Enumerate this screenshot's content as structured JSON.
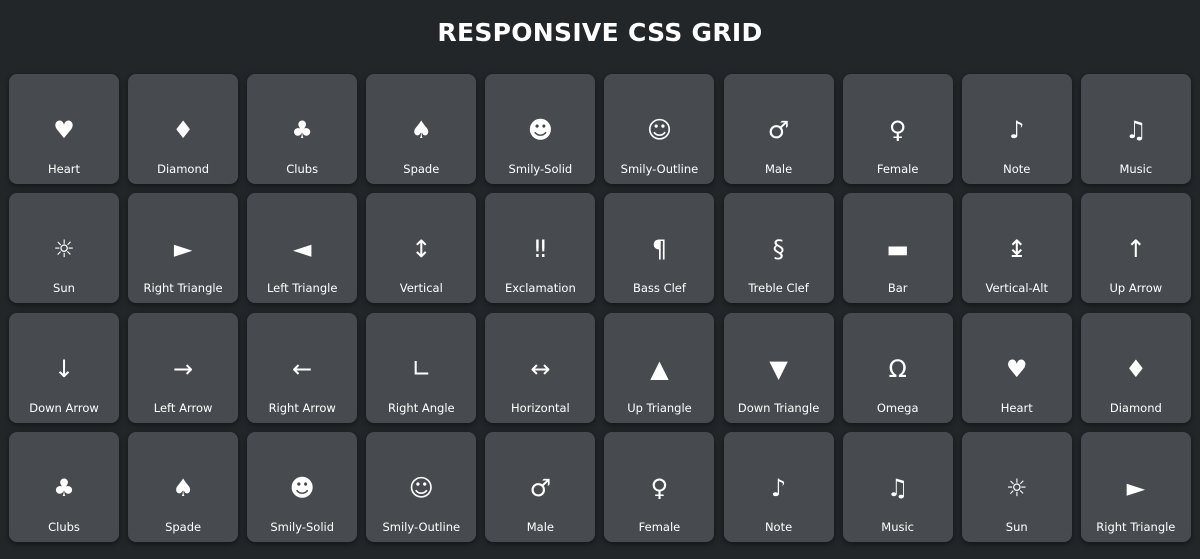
{
  "header": {
    "title": "RESPONSIVE CSS GRID"
  },
  "colors": {
    "background": "#222629",
    "tile": "#474b50",
    "text": "#ffffff"
  },
  "tiles": [
    {
      "label": "Heart",
      "icon": "heart-icon",
      "glyph": "♥"
    },
    {
      "label": "Diamond",
      "icon": "diamond-icon",
      "glyph": "♦"
    },
    {
      "label": "Clubs",
      "icon": "clubs-icon",
      "glyph": "♣"
    },
    {
      "label": "Spade",
      "icon": "spade-icon",
      "glyph": "♠"
    },
    {
      "label": "Smily-Solid",
      "icon": "smiley-solid-icon",
      "glyph": "☻"
    },
    {
      "label": "Smily-Outline",
      "icon": "smiley-outline-icon",
      "glyph": "☺"
    },
    {
      "label": "Male",
      "icon": "male-icon",
      "glyph": "♂"
    },
    {
      "label": "Female",
      "icon": "female-icon",
      "glyph": "♀"
    },
    {
      "label": "Note",
      "icon": "note-icon",
      "glyph": "♪"
    },
    {
      "label": "Music",
      "icon": "music-icon",
      "glyph": "♫"
    },
    {
      "label": "Sun",
      "icon": "sun-icon",
      "glyph": "☼"
    },
    {
      "label": "Right Triangle",
      "icon": "right-triangle-icon",
      "glyph": "►"
    },
    {
      "label": "Left Triangle",
      "icon": "left-triangle-icon",
      "glyph": "◄"
    },
    {
      "label": "Vertical",
      "icon": "vertical-arrow-icon",
      "glyph": "↕"
    },
    {
      "label": "Exclamation",
      "icon": "double-exclamation-icon",
      "glyph": "‼"
    },
    {
      "label": "Bass Clef",
      "icon": "pilcrow-icon",
      "glyph": "¶"
    },
    {
      "label": "Treble Clef",
      "icon": "section-sign-icon",
      "glyph": "§"
    },
    {
      "label": "Bar",
      "icon": "bar-icon",
      "glyph": "▬"
    },
    {
      "label": "Vertical-Alt",
      "icon": "vertical-alt-arrow-icon",
      "glyph": "↨"
    },
    {
      "label": "Up Arrow",
      "icon": "up-arrow-icon",
      "glyph": "↑"
    },
    {
      "label": "Down Arrow",
      "icon": "down-arrow-icon",
      "glyph": "↓"
    },
    {
      "label": "Left Arrow",
      "icon": "right-arrow-icon",
      "glyph": "→"
    },
    {
      "label": "Right Arrow",
      "icon": "left-arrow-icon",
      "glyph": "←"
    },
    {
      "label": "Right Angle",
      "icon": "right-angle-icon",
      "glyph": "∟"
    },
    {
      "label": "Horizontal",
      "icon": "horizontal-arrow-icon",
      "glyph": "↔"
    },
    {
      "label": "Up Triangle",
      "icon": "up-triangle-icon",
      "glyph": "▲"
    },
    {
      "label": "Down Triangle",
      "icon": "down-triangle-icon",
      "glyph": "▼"
    },
    {
      "label": "Omega",
      "icon": "omega-icon",
      "glyph": "Ω"
    },
    {
      "label": "Heart",
      "icon": "heart-icon",
      "glyph": "♥"
    },
    {
      "label": "Diamond",
      "icon": "diamond-icon",
      "glyph": "♦"
    },
    {
      "label": "Clubs",
      "icon": "clubs-icon",
      "glyph": "♣"
    },
    {
      "label": "Spade",
      "icon": "spade-icon",
      "glyph": "♠"
    },
    {
      "label": "Smily-Solid",
      "icon": "smiley-solid-icon",
      "glyph": "☻"
    },
    {
      "label": "Smily-Outline",
      "icon": "smiley-outline-icon",
      "glyph": "☺"
    },
    {
      "label": "Male",
      "icon": "male-icon",
      "glyph": "♂"
    },
    {
      "label": "Female",
      "icon": "female-icon",
      "glyph": "♀"
    },
    {
      "label": "Note",
      "icon": "note-icon",
      "glyph": "♪"
    },
    {
      "label": "Music",
      "icon": "music-icon",
      "glyph": "♫"
    },
    {
      "label": "Sun",
      "icon": "sun-icon",
      "glyph": "☼"
    },
    {
      "label": "Right Triangle",
      "icon": "right-triangle-icon",
      "glyph": "►"
    }
  ]
}
